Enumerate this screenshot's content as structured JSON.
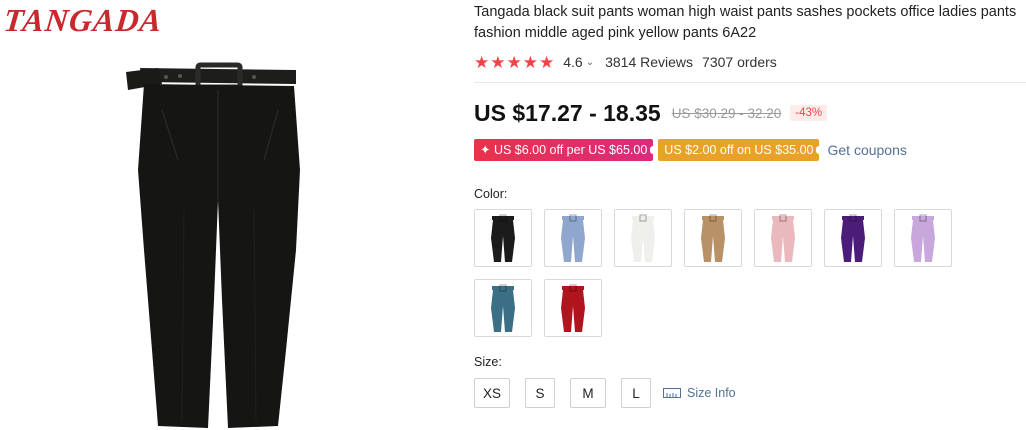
{
  "brand": {
    "logo_text": "TANGADA"
  },
  "product": {
    "title": "Tangada black suit pants woman high waist pants sashes pockets office ladies pants fashion middle aged pink yellow pants 6A22",
    "rating": {
      "stars": 5,
      "value": "4.6",
      "reviews": "3814 Reviews",
      "orders": "7307 orders"
    },
    "price": {
      "current": "US $17.27 - 18.35",
      "original": "US $30.29 - 32.20",
      "discount": "-43%"
    },
    "coupons": [
      {
        "text": "✦ US $6.00 off per US $65.00"
      },
      {
        "text": "US $2.00 off on US $35.00"
      }
    ],
    "get_coupons": "Get coupons",
    "color_label": "Color:",
    "colors": [
      {
        "name": "black",
        "hex": "#1b1b1b"
      },
      {
        "name": "light-blue",
        "hex": "#8fa6cf"
      },
      {
        "name": "white",
        "hex": "#efefeb"
      },
      {
        "name": "khaki",
        "hex": "#b89266"
      },
      {
        "name": "pink",
        "hex": "#e9b9bd"
      },
      {
        "name": "purple",
        "hex": "#4b1d78"
      },
      {
        "name": "lilac",
        "hex": "#c8a8dc"
      },
      {
        "name": "teal-blue",
        "hex": "#3b6f86"
      },
      {
        "name": "red",
        "hex": "#b0141c"
      }
    ],
    "size_label": "Size:",
    "sizes": [
      "XS",
      "S",
      "M",
      "L"
    ],
    "size_info": "Size Info"
  },
  "colors": {
    "accent": "#f0444b",
    "link": "#527197",
    "main_pants": "#151614"
  }
}
